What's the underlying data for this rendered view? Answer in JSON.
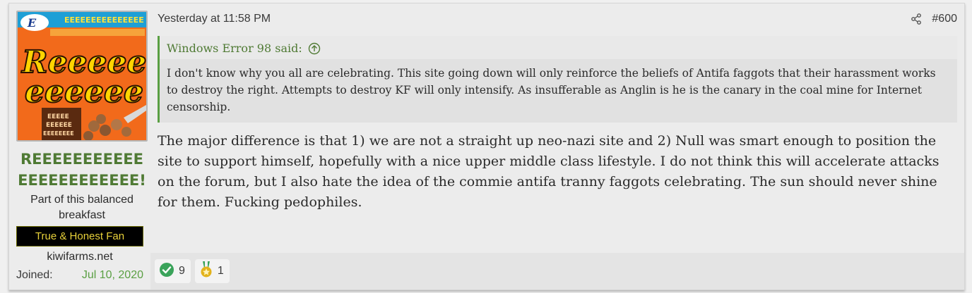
{
  "post": {
    "author": {
      "avatar_text": {
        "top_banner": "EEEEEEEEEEEEEEE",
        "corner_logo": "E",
        "big_line1": "Reeeee",
        "big_line2": "eeeeee",
        "small_box": [
          "EEEEE",
          "EEEEEE",
          "EEEEEEEE"
        ]
      },
      "username": "REEEEEEEEEEEEEEEEEEEEEEE!",
      "title": "Part of this balanced breakfast",
      "banner": "True & Honest Fan",
      "site": "kiwifarms.net",
      "joined_label": "Joined:",
      "joined_value": "Jul 10, 2020"
    },
    "timestamp": "Yesterday at 11:58 PM",
    "post_number": "#600",
    "quote": {
      "author_said": "Windows Error 98 said:",
      "text": "I don't know why you all are celebrating. This site going down will only reinforce the beliefs of Antifa faggots that their harassment works to destroy the right. Attempts to destroy KF will only intensify. As insufferable as Anglin is he is the canary in the coal mine for Internet censorship."
    },
    "message": "The major difference is that 1) we are not a straight up neo-nazi site and 2) Null was smart enough to position the site to support himself, hopefully with a nice upper middle class lifestyle. I do not think this will accelerate attacks on the forum, but I also hate the idea of the commie antifa tranny faggots celebrating. The sun should never shine for them. Fucking pedophiles.",
    "reactions": [
      {
        "icon": "checkmark-icon",
        "count": "9",
        "color": "#3aa35a"
      },
      {
        "icon": "medal-icon",
        "count": "1",
        "color": "#e2b21b"
      }
    ]
  }
}
